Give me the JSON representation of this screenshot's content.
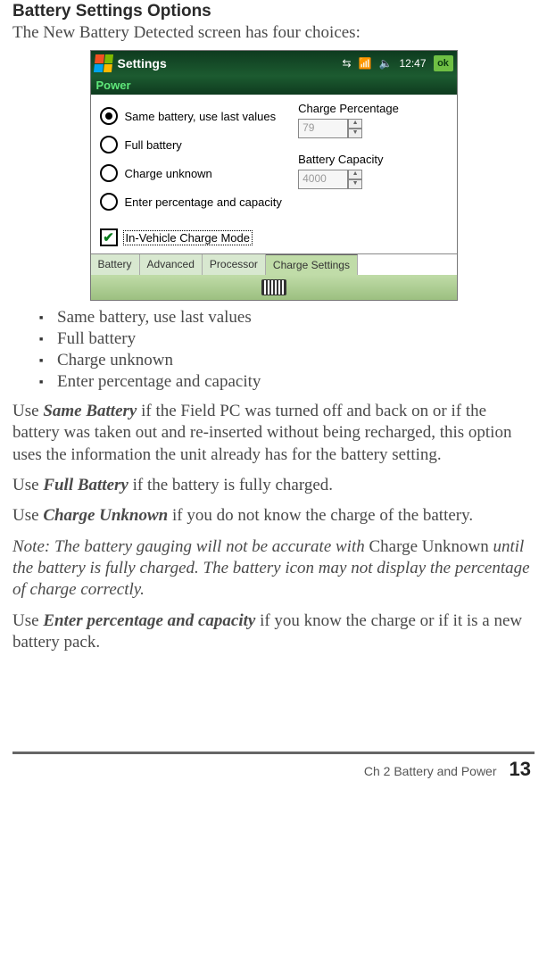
{
  "heading": "Battery Settings Options",
  "intro": "The New Battery Detected screen has four choices:",
  "device": {
    "titlebar": {
      "title": "Settings",
      "time": "12:47",
      "ok": "ok"
    },
    "subtitle": "Power",
    "radios": {
      "r0": "Same battery, use last values",
      "r1": "Full battery",
      "r2": "Charge unknown",
      "r3": "Enter percentage and capacity"
    },
    "fields": {
      "charge_pct_label": "Charge Percentage",
      "charge_pct_value": "79",
      "capacity_label": "Battery Capacity",
      "capacity_value": "4000"
    },
    "checkbox_label": "In-Vehicle Charge Mode",
    "tabs": {
      "t0": "Battery",
      "t1": "Advanced",
      "t2": "Processor",
      "t3": "Charge Settings"
    }
  },
  "bullets": {
    "b0": "Same battery, use last values",
    "b1": "Full battery",
    "b2": "Charge unknown",
    "b3": "Enter percentage and capacity"
  },
  "p1": {
    "pre": "Use ",
    "em": "Same Battery",
    "post": " if the Field PC was turned off and back on or if the battery was taken out and re-inserted without being recharged, this option uses the information the unit already has for the battery setting."
  },
  "p2": {
    "pre": "Use ",
    "em": "Full Battery",
    "post": " if the battery is fully charged."
  },
  "p3": {
    "pre": "Use ",
    "em": "Charge Unknown",
    "post": " if you do not know the charge of the battery."
  },
  "note": {
    "a": "Note: The battery gauging will not be accurate with ",
    "b": "Charge Unknown",
    "c": " until the battery is fully charged. The battery icon may not display the percentage of charge correctly."
  },
  "p4": {
    "pre": "Use ",
    "em": "Enter percentage and capacity",
    "post": " if you know the charge or if it is a new battery pack."
  },
  "footer": {
    "chapter": "Ch 2    Battery and Power",
    "page": "13"
  },
  "chart_data": null
}
